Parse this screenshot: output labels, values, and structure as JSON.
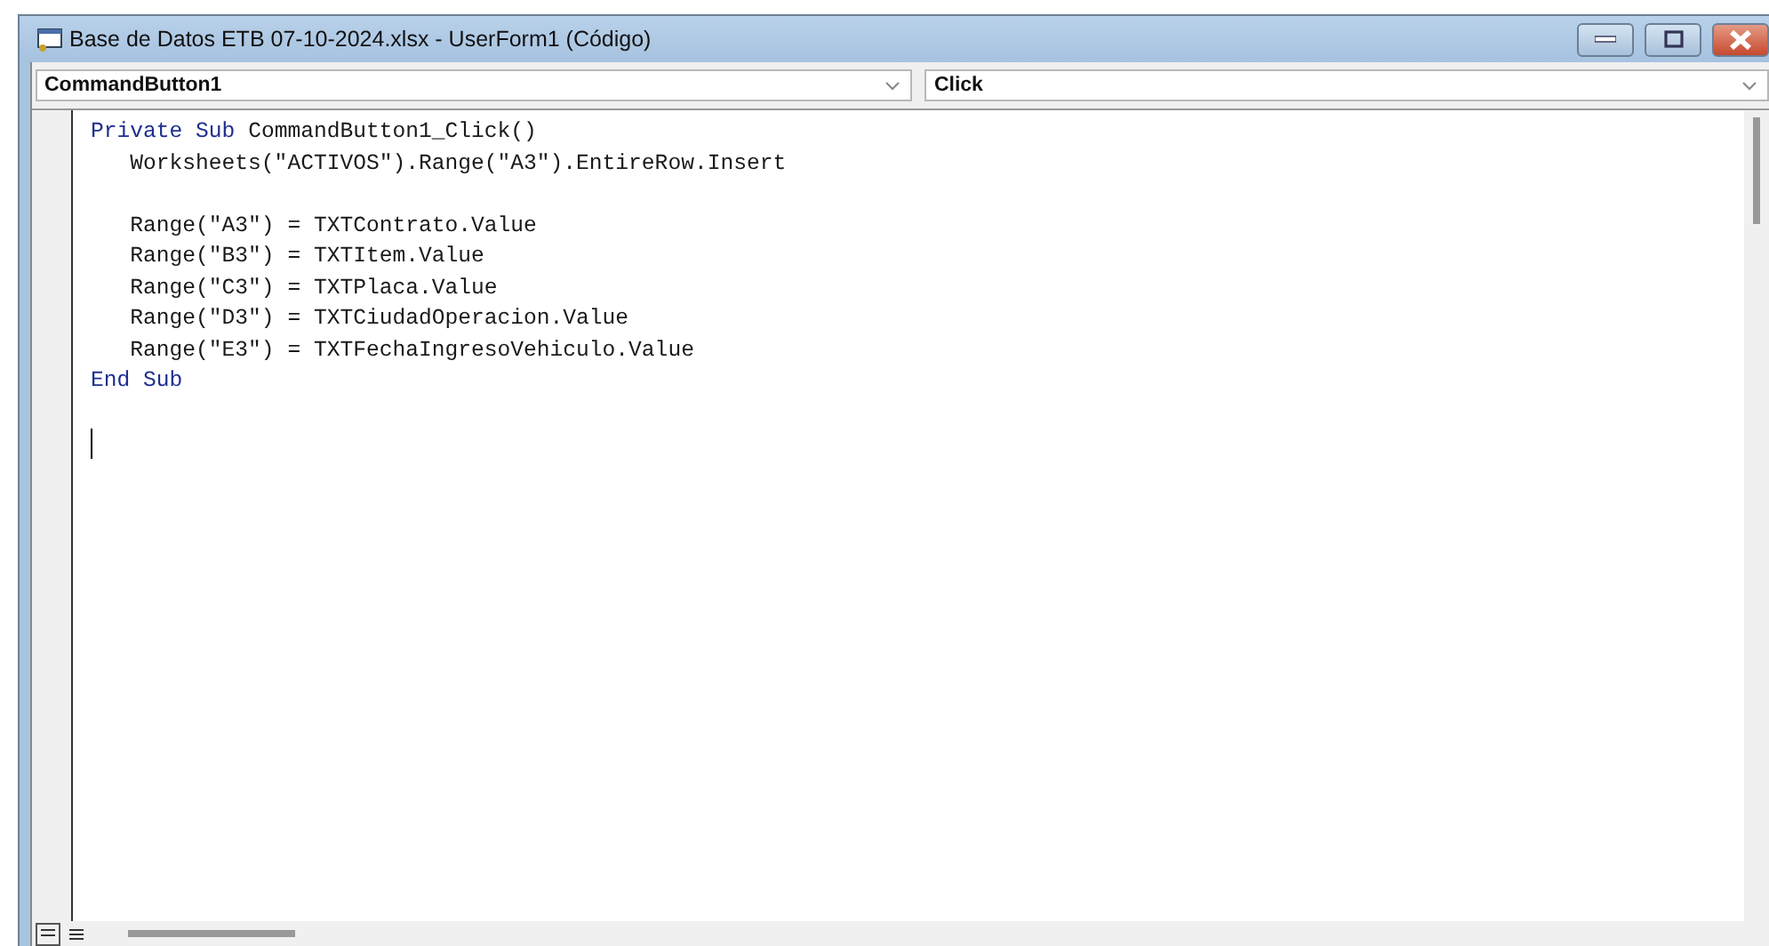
{
  "window": {
    "title": "Base de Datos ETB  07-10-2024.xlsx - UserForm1 (Código)"
  },
  "object_dropdown": {
    "value": "CommandButton1"
  },
  "procedure_dropdown": {
    "value": "Click"
  },
  "code": [
    {
      "kind": "code",
      "tokens": [
        {
          "kind": "keyword",
          "text": "Private Sub"
        },
        {
          "kind": "plain",
          "text": " CommandButton1_Click()"
        }
      ]
    },
    {
      "kind": "code",
      "tokens": [
        {
          "kind": "plain",
          "text": "   Worksheets(\"ACTIVOS\").Range(\"A3\").EntireRow.Insert"
        }
      ]
    },
    {
      "kind": "blank"
    },
    {
      "kind": "code",
      "tokens": [
        {
          "kind": "plain",
          "text": "   Range(\"A3\") = TXTContrato.Value"
        }
      ]
    },
    {
      "kind": "code",
      "tokens": [
        {
          "kind": "plain",
          "text": "   Range(\"B3\") = TXTItem.Value"
        }
      ]
    },
    {
      "kind": "code",
      "tokens": [
        {
          "kind": "plain",
          "text": "   Range(\"C3\") = TXTPlaca.Value"
        }
      ]
    },
    {
      "kind": "code",
      "tokens": [
        {
          "kind": "plain",
          "text": "   Range(\"D3\") = TXTCiudadOperacion.Value"
        }
      ]
    },
    {
      "kind": "code",
      "tokens": [
        {
          "kind": "plain",
          "text": "   Range(\"E3\") = TXTFechaIngresoVehiculo.Value"
        }
      ]
    },
    {
      "kind": "code",
      "tokens": [
        {
          "kind": "keyword",
          "text": "End Sub"
        }
      ]
    },
    {
      "kind": "blank"
    },
    {
      "kind": "cursor"
    }
  ]
}
